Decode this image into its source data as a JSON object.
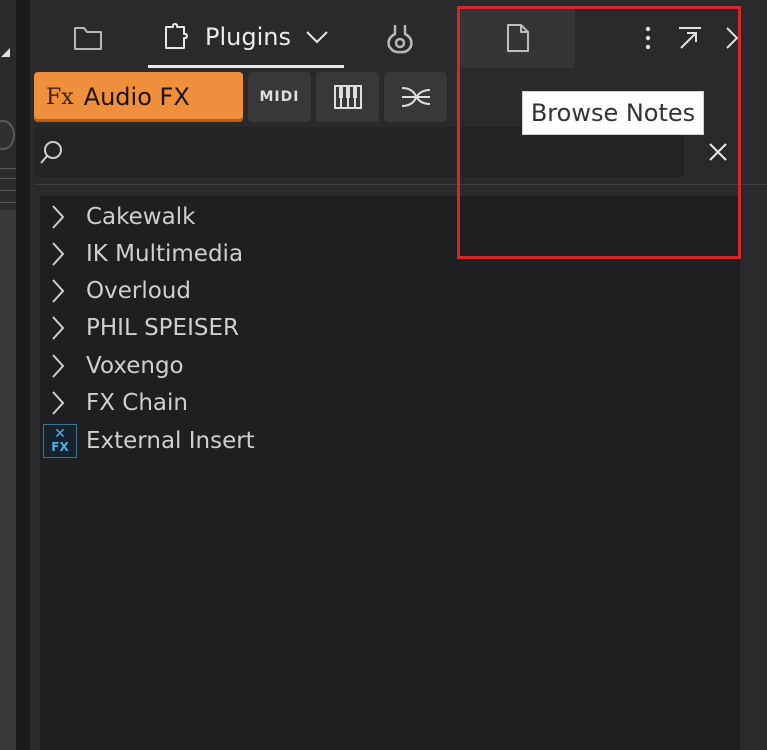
{
  "tabs": {
    "plugins_label": "Plugins"
  },
  "categories": {
    "audio_fx_icon": "Fx",
    "audio_fx_label": "Audio FX",
    "midi_label": "MIDI"
  },
  "tooltip": {
    "text": "Browse Notes"
  },
  "search": {
    "value": "",
    "placeholder": ""
  },
  "list": {
    "items": [
      {
        "label": "Cakewalk",
        "icon": "chevron-right-icon"
      },
      {
        "label": "IK Multimedia",
        "icon": "chevron-right-icon"
      },
      {
        "label": "Overloud",
        "icon": "chevron-right-icon"
      },
      {
        "label": "PHIL SPEISER",
        "icon": "chevron-right-icon"
      },
      {
        "label": "Voxengo",
        "icon": "chevron-right-icon"
      },
      {
        "label": "FX Chain",
        "icon": "chevron-right-icon"
      },
      {
        "label": "External Insert",
        "icon": "external-insert-fx-icon"
      }
    ]
  },
  "colors": {
    "accent": "#f08f3b",
    "highlight_box": "#d6252d",
    "panel_bg": "#2a2a2d"
  }
}
